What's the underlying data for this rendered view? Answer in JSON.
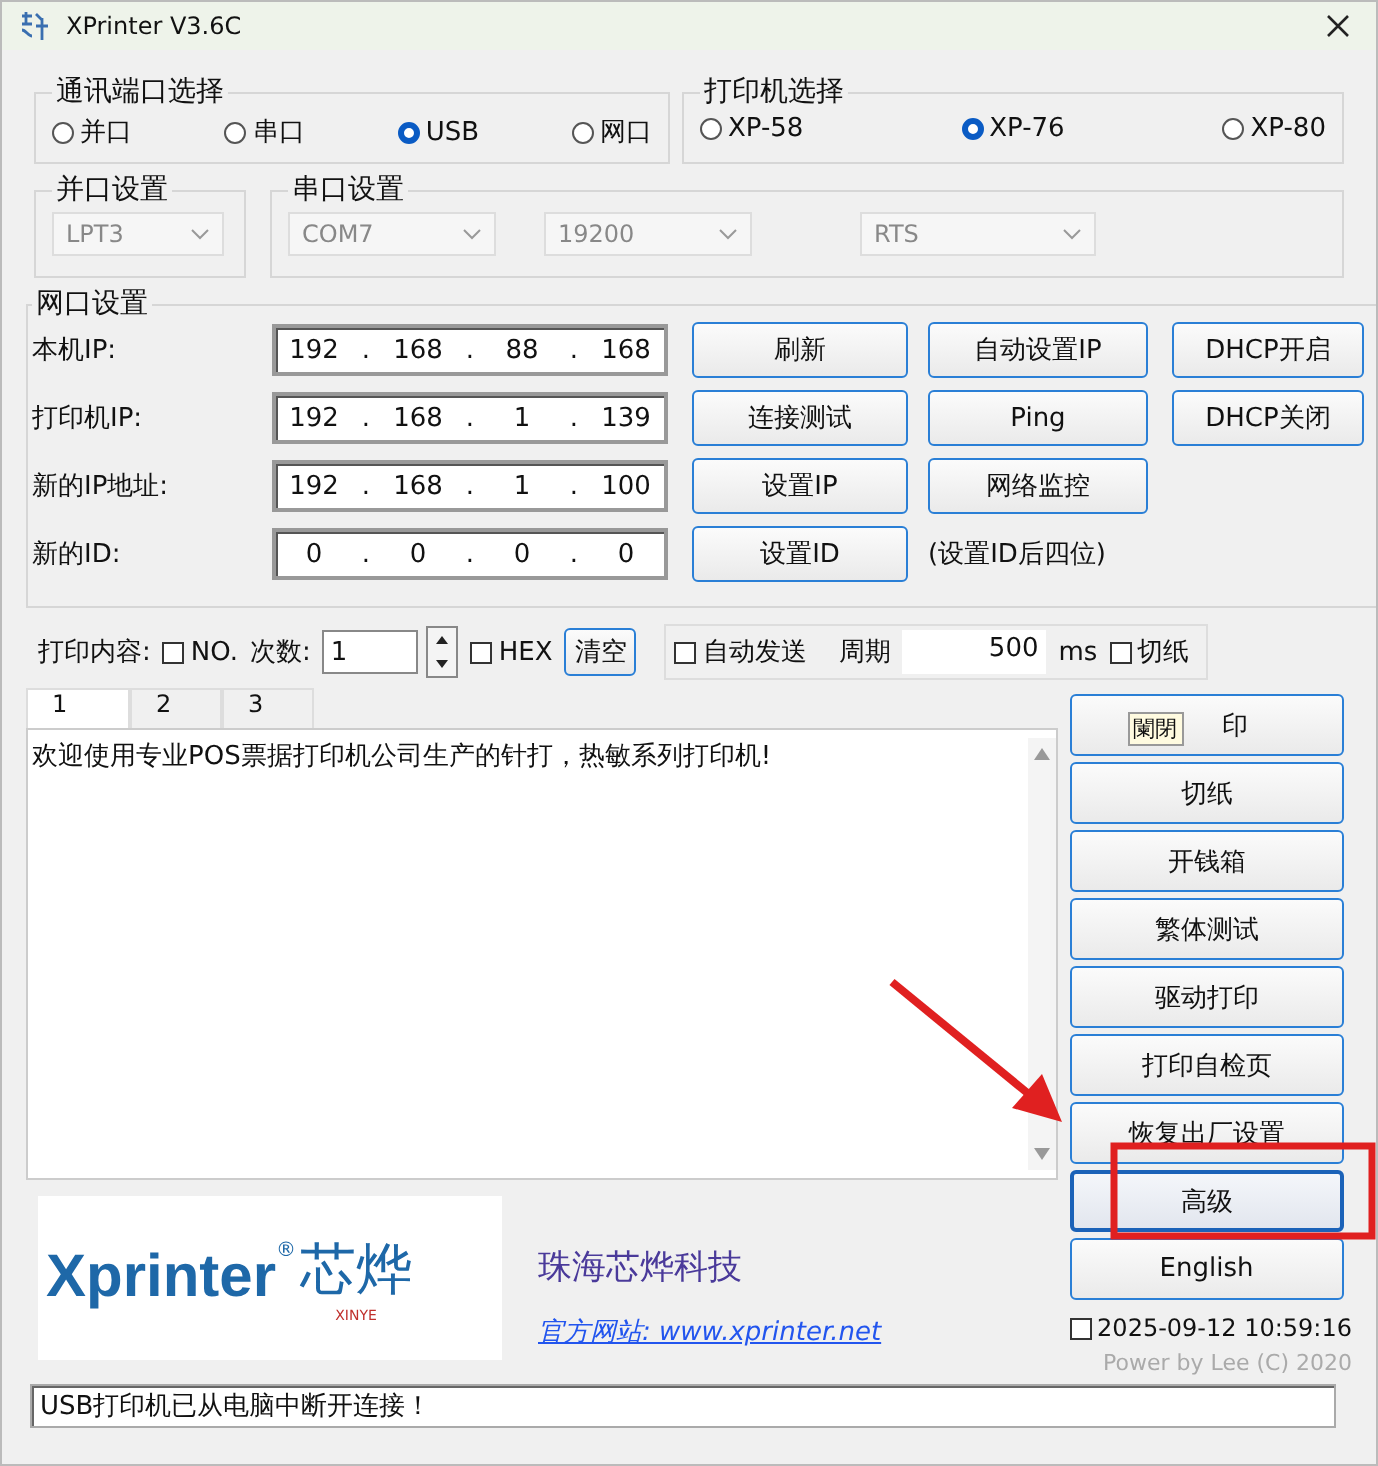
{
  "window": {
    "title": "XPrinter V3.6C"
  },
  "port_group": {
    "title": "通讯端口选择",
    "options": [
      {
        "label": "并口",
        "selected": false
      },
      {
        "label": "串口",
        "selected": false
      },
      {
        "label": "USB",
        "selected": true
      },
      {
        "label": "网口",
        "selected": false
      }
    ]
  },
  "printer_group": {
    "title": "打印机选择",
    "options": [
      {
        "label": "XP-58",
        "selected": false
      },
      {
        "label": "XP-76",
        "selected": true
      },
      {
        "label": "XP-80",
        "selected": false
      }
    ]
  },
  "parallel_group": {
    "title": "并口设置",
    "disabled": true,
    "selects": [
      "LPT3"
    ]
  },
  "serial_group": {
    "title": "串口设置",
    "disabled": true,
    "selects": [
      "COM7",
      "19200",
      "RTS"
    ]
  },
  "network_group": {
    "title": "网口设置",
    "separator": ".",
    "fields": [
      {
        "label": "本机IP:",
        "octets": [
          "192",
          "168",
          "88",
          "168"
        ]
      },
      {
        "label": "打印机IP:",
        "octets": [
          "192",
          "168",
          "1",
          "139"
        ]
      },
      {
        "label": "新的IP地址:",
        "octets": [
          "192",
          "168",
          "1",
          "100"
        ]
      },
      {
        "label": "新的ID:",
        "octets": [
          "0",
          "0",
          "0",
          "0"
        ]
      }
    ],
    "button_rows": [
      [
        "刷新",
        "自动设置IP",
        "DHCP开启"
      ],
      [
        "连接测试",
        "Ping",
        "DHCP关闭"
      ],
      [
        "设置IP",
        "网络监控"
      ],
      [
        "设置ID"
      ]
    ],
    "note": "(设置ID后四位)"
  },
  "print_options": {
    "label": "打印内容:",
    "number": {
      "label": "NO.",
      "checked": false
    },
    "count_label": "次数:",
    "count": "1",
    "hex": {
      "label": "HEX",
      "checked": false
    },
    "clear_button": "清空",
    "auto_send": {
      "label": "自动发送",
      "checked": false
    },
    "period_label": "周期",
    "period": "500",
    "unit": "ms",
    "cut": {
      "label": "切纸",
      "checked": false
    }
  },
  "tabs": [
    {
      "label": "1",
      "selected": true
    },
    {
      "label": "2",
      "selected": false
    },
    {
      "label": "3",
      "selected": false
    }
  ],
  "content": "欢迎使用专业POS票据打印机公司生产的针打，热敏系列打印机!",
  "side_buttons": [
    {
      "label": "印",
      "focused": false,
      "tooltip": "闌閉"
    },
    {
      "label": "切纸",
      "focused": false
    },
    {
      "label": "开钱箱",
      "focused": false
    },
    {
      "label": "繁体测试",
      "focused": false
    },
    {
      "label": "驱动打印",
      "focused": false
    },
    {
      "label": "打印自检页",
      "focused": false
    },
    {
      "label": "恢复出厂设置",
      "focused": false
    },
    {
      "label": "高级",
      "focused": true
    },
    {
      "label": "English",
      "focused": false
    }
  ],
  "footer": {
    "logo": {
      "brand": "Xprinter",
      "mark": "®",
      "chinese": "芯烨",
      "sub": "XINYE"
    },
    "company": "珠海芯烨科技",
    "website": "官方网站: www.xprinter.net",
    "clock": {
      "checked": false,
      "text": "2025-09-12 10:59:16"
    },
    "credit": "Power by Lee (C) 2020"
  },
  "status_bar": "USB打印机已从电脑中断开连接！"
}
